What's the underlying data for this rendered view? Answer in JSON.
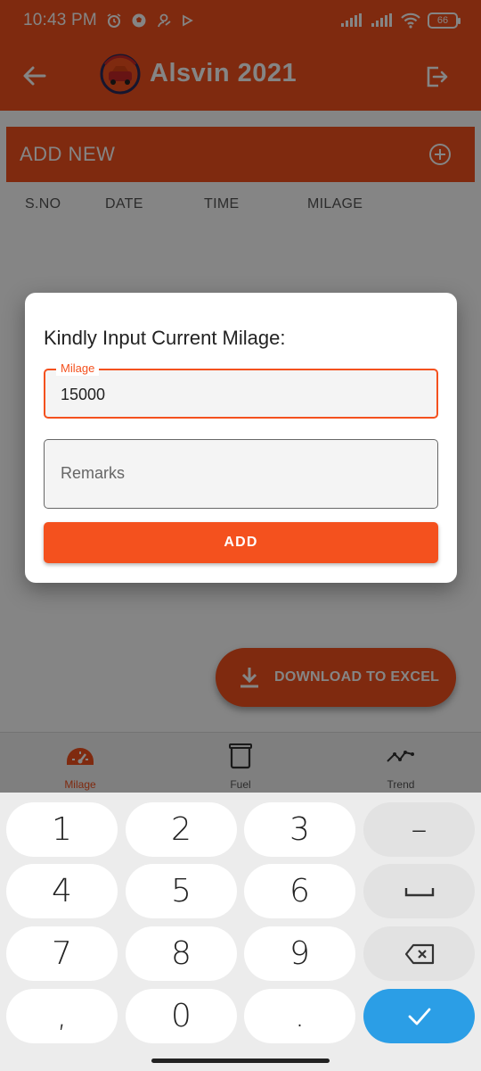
{
  "status_bar": {
    "time": "10:43 PM",
    "battery": "66"
  },
  "app_bar": {
    "title": "Alsvin 2021",
    "icons": [
      "back-arrow-icon",
      "car-logo",
      "logout-icon"
    ]
  },
  "list": {
    "add_new_label": "ADD NEW",
    "columns": [
      "S.NO",
      "DATE",
      "TIME",
      "MILAGE"
    ]
  },
  "fab": {
    "label": "DOWNLOAD TO EXCEL"
  },
  "bottom_nav": [
    {
      "label": "Milage",
      "icon": "speedometer-icon",
      "active": true
    },
    {
      "label": "Fuel",
      "icon": "fuel-can-icon",
      "active": false
    },
    {
      "label": "Trend",
      "icon": "trend-line-icon",
      "active": false
    }
  ],
  "dialog": {
    "title": "Kindly Input Current Milage:",
    "milage_label": "Milage",
    "milage_value": "15000",
    "remarks_placeholder": "Remarks",
    "add_button": "ADD"
  },
  "keyboard": {
    "keys": [
      "1",
      "2",
      "3",
      "–",
      "4",
      "5",
      "6",
      "␣",
      "7",
      "8",
      "9",
      "⌫",
      ",",
      "0",
      ".",
      "✓"
    ]
  },
  "colors": {
    "accent": "#f4511e",
    "enter_key": "#2b9ee6"
  }
}
